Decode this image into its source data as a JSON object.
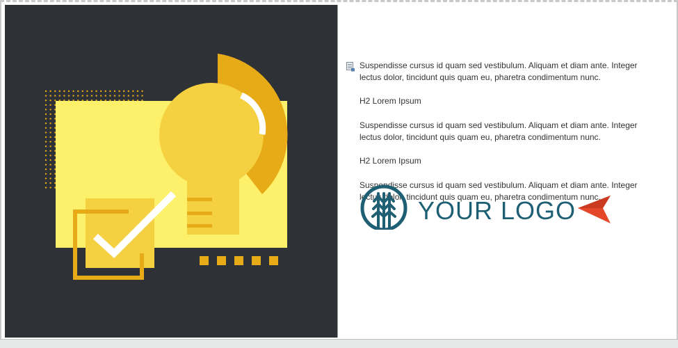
{
  "document": {
    "paragraphs": [
      "Suspendisse cursus id quam sed vestibulum. Aliquam et diam ante. Integer lectus dolor, tincidunt quis quam eu, pharetra condimentum nunc.",
      "H2 Lorem Ipsum",
      "Suspendisse cursus id quam sed vestibulum. Aliquam et diam ante. Integer lectus dolor, tincidunt quis quam eu, pharetra condimentum nunc.",
      "H2 Lorem Ipsum",
      "Suspendisse cursus id quam sed vestibulum. Aliquam et diam ante. Integer lectus dolor, tincidunt quis quam eu, pharetra condimentum nunc."
    ],
    "logo_text": "YOUR LOGO"
  },
  "icons": {
    "paragraph_marker": "paragraph-icon",
    "logo_mark": "tree-icon",
    "pointer": "arrow-pointer-icon",
    "illustration": "lightbulb-checkbox-illustration"
  },
  "colors": {
    "hero_background": "#2e3236",
    "light_yellow": "#fdf06b",
    "bulb_yellow": "#f5d040",
    "amber": "#e8ab18",
    "logo_teal": "#1e5f74",
    "pointer_red": "#e4472a"
  }
}
